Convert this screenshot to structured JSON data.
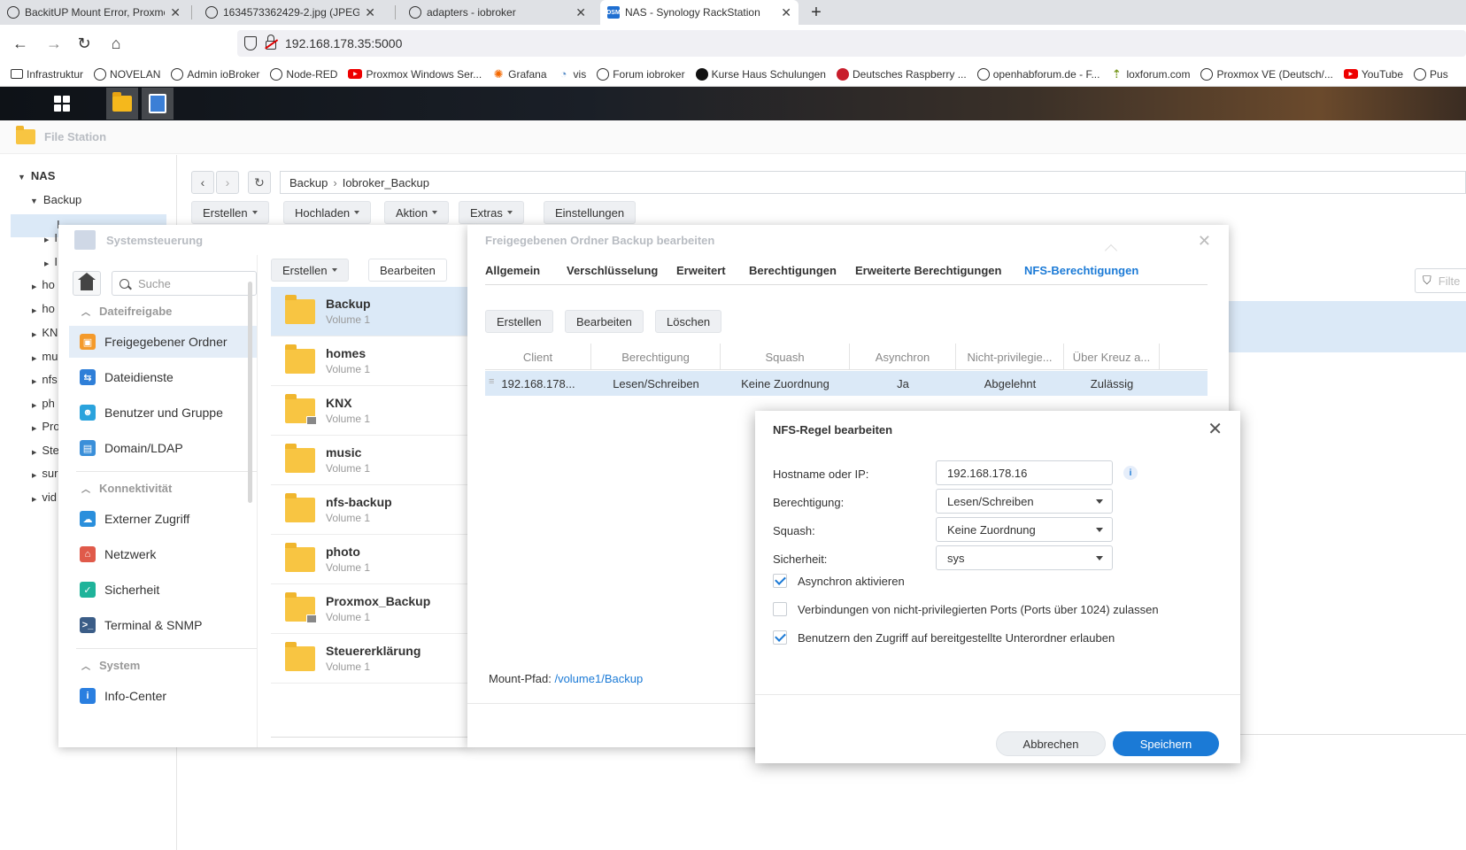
{
  "browser": {
    "tabs": [
      {
        "title": "BackitUP Mount Error, Proxmox",
        "icon": "iobroker-icon"
      },
      {
        "title": "1634573362429-2.jpg (JPEG-Grafik",
        "icon": "iobroker-icon"
      },
      {
        "title": "adapters - iobroker",
        "icon": "iobroker-icon"
      },
      {
        "title": "NAS - Synology RackStation",
        "icon": "dsm-icon",
        "icon_text": "DSM"
      }
    ],
    "url": "192.168.178.35:5000",
    "bookmarks": [
      {
        "label": "Infrastruktur",
        "icon": "folder-icon"
      },
      {
        "label": "NOVELAN",
        "icon": "globe-icon"
      },
      {
        "label": "Admin ioBroker",
        "icon": "globe-icon"
      },
      {
        "label": "Node-RED",
        "icon": "globe-icon"
      },
      {
        "label": "Proxmox Windows Ser...",
        "icon": "youtube-icon"
      },
      {
        "label": "Grafana",
        "icon": "grafana-icon"
      },
      {
        "label": "vis",
        "icon": "vis-icon"
      },
      {
        "label": "Forum iobroker",
        "icon": "iobroker-icon"
      },
      {
        "label": "Kurse Haus Schulungen",
        "icon": "black-dot-icon"
      },
      {
        "label": "Deutsches Raspberry ...",
        "icon": "raspberry-icon"
      },
      {
        "label": "openhabforum.de - F...",
        "icon": "globe-icon"
      },
      {
        "label": "loxforum.com",
        "icon": "loxone-icon"
      },
      {
        "label": "Proxmox VE (Deutsch/...",
        "icon": "globe-icon"
      },
      {
        "label": "YouTube",
        "icon": "youtube-icon"
      },
      {
        "label": "Pus",
        "icon": "globe-icon"
      }
    ]
  },
  "file_station": {
    "title": "File Station",
    "tree": {
      "root": "NAS",
      "expanded": "Backup",
      "child_partial": "I",
      "items": [
        "ho",
        "ho",
        "KN",
        "mu",
        "nfs",
        "ph",
        "Pro",
        "Ste",
        "sur",
        "vid"
      ],
      "hidden_children": [
        "I",
        "I"
      ]
    },
    "path": [
      "Backup",
      "Iobroker_Backup"
    ],
    "toolbar": [
      "Erstellen",
      "Hochladen",
      "Aktion",
      "Extras",
      "Einstellungen"
    ],
    "filter_placeholder": "Filte"
  },
  "control_panel": {
    "title": "Systemsteuerung",
    "search_placeholder": "Suche",
    "sections": [
      {
        "title": "Dateifreigabe",
        "items": [
          {
            "label": "Freigegebener Ordner",
            "icon": "shared-folder-icon",
            "color": "#f49a2b",
            "selected": true
          },
          {
            "label": "Dateidienste",
            "icon": "file-services-icon",
            "color": "#2f7fd8"
          },
          {
            "label": "Benutzer und Gruppe",
            "icon": "user-group-icon",
            "color": "#2aa3dd"
          },
          {
            "label": "Domain/LDAP",
            "icon": "domain-icon",
            "color": "#3a8fd9"
          }
        ]
      },
      {
        "title": "Konnektivität",
        "items": [
          {
            "label": "Externer Zugriff",
            "icon": "external-access-icon",
            "color": "#2a8fdc"
          },
          {
            "label": "Netzwerk",
            "icon": "network-icon",
            "color": "#e05a4a"
          },
          {
            "label": "Sicherheit",
            "icon": "security-icon",
            "color": "#1fb39a"
          },
          {
            "label": "Terminal & SNMP",
            "icon": "terminal-icon",
            "color": "#3b5d87"
          }
        ]
      },
      {
        "title": "System",
        "items": [
          {
            "label": "Info-Center",
            "icon": "info-center-icon",
            "color": "#2a7fe0"
          }
        ]
      }
    ],
    "toolbar": [
      "Erstellen",
      "Bearbeiten"
    ],
    "folders": [
      {
        "name": "Backup",
        "volume": "Volume 1",
        "locked": false,
        "selected": true
      },
      {
        "name": "homes",
        "volume": "Volume 1",
        "locked": false
      },
      {
        "name": "KNX",
        "volume": "Volume 1",
        "locked": true
      },
      {
        "name": "music",
        "volume": "Volume 1",
        "locked": false
      },
      {
        "name": "nfs-backup",
        "volume": "Volume 1",
        "locked": false
      },
      {
        "name": "photo",
        "volume": "Volume 1",
        "locked": false
      },
      {
        "name": "Proxmox_Backup",
        "volume": "Volume 1",
        "locked": true
      },
      {
        "name": "Steuererklärung",
        "volume": "Volume 1",
        "locked": false
      }
    ]
  },
  "shared_folder_editor": {
    "title": "Freigegebenen Ordner Backup bearbeiten",
    "tabs": [
      "Allgemein",
      "Verschlüsselung",
      "Erweitert",
      "Berechtigungen",
      "Erweiterte Berechtigungen",
      "NFS-Berechtigungen"
    ],
    "active_tab": "NFS-Berechtigungen",
    "actions": [
      "Erstellen",
      "Bearbeiten",
      "Löschen"
    ],
    "columns": [
      "Client",
      "Berechtigung",
      "Squash",
      "Asynchron",
      "Nicht-privilegie...",
      "Über Kreuz a..."
    ],
    "rows": [
      [
        "192.168.178...",
        "Lesen/Schreiben",
        "Keine Zuordnung",
        "Ja",
        "Abgelehnt",
        "Zulässig"
      ]
    ],
    "mount_label": "Mount-Pfad:",
    "mount_path": "/volume1/Backup"
  },
  "nfs_rule_dialog": {
    "title": "NFS-Regel bearbeiten",
    "fields": {
      "hostname_label": "Hostname oder IP:",
      "hostname_value": "192.168.178.16",
      "permission_label": "Berechtigung:",
      "permission_value": "Lesen/Schreiben",
      "squash_label": "Squash:",
      "squash_value": "Keine Zuordnung",
      "security_label": "Sicherheit:",
      "security_value": "sys"
    },
    "checkboxes": [
      {
        "label": "Asynchron aktivieren",
        "checked": true
      },
      {
        "label": "Verbindungen von nicht-privilegierten Ports (Ports über 1024) zulassen",
        "checked": false
      },
      {
        "label": "Benutzern den Zugriff auf bereitgestellte Unterordner erlauben",
        "checked": true
      }
    ],
    "cancel_label": "Abbrechen",
    "save_label": "Speichern"
  }
}
